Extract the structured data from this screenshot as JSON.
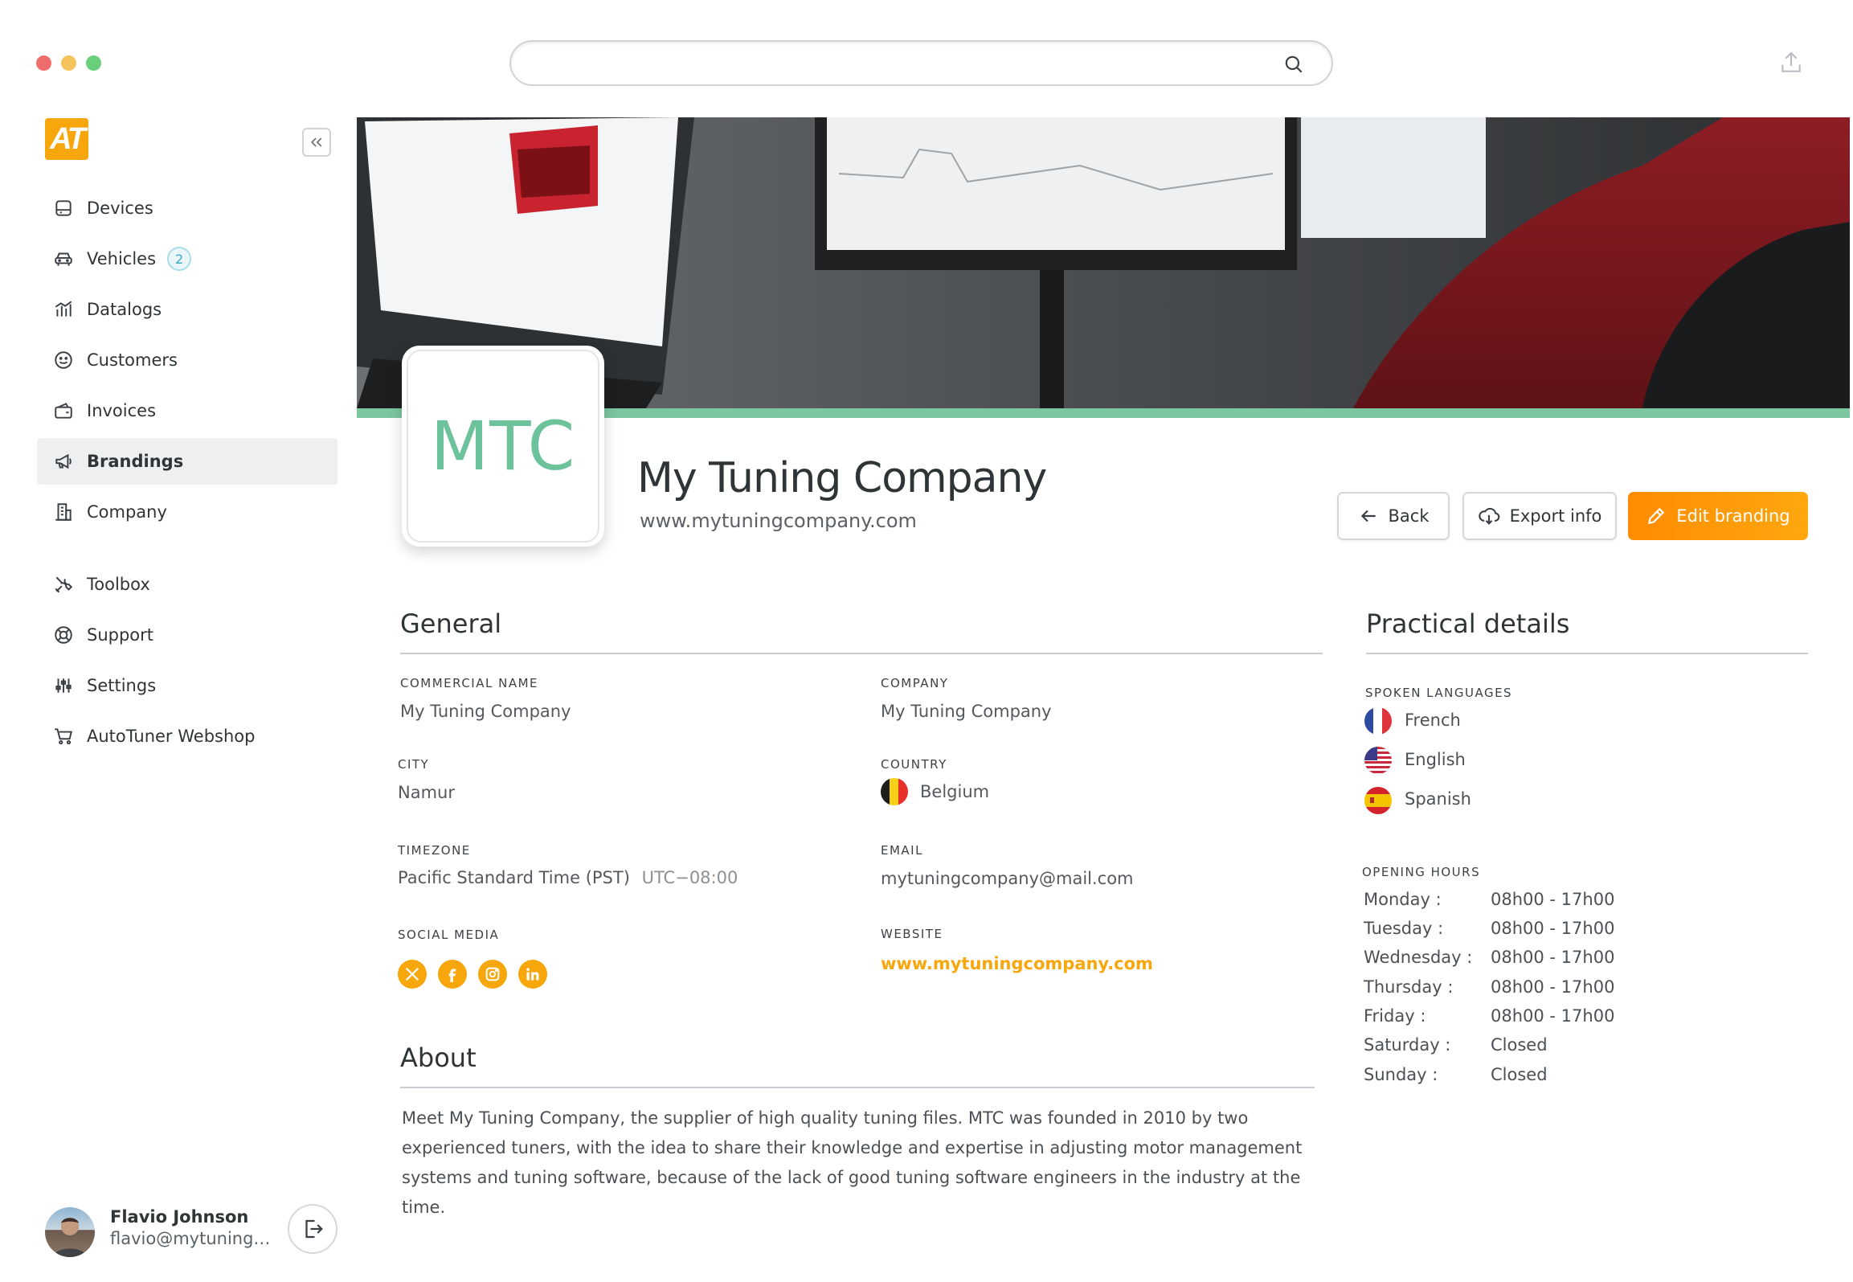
{
  "window": {
    "dots": [
      "#ef6c6c",
      "#f6c25b",
      "#69cf7b"
    ]
  },
  "search": {
    "placeholder": ""
  },
  "logo": {
    "text": "AT"
  },
  "sidebar": {
    "items": [
      {
        "label": "Devices"
      },
      {
        "label": "Vehicles",
        "badge": "2"
      },
      {
        "label": "Datalogs"
      },
      {
        "label": "Customers"
      },
      {
        "label": "Invoices"
      },
      {
        "label": "Brandings",
        "active": true
      },
      {
        "label": "Company"
      },
      {
        "label": "Toolbox"
      },
      {
        "label": "Support"
      },
      {
        "label": "Settings"
      },
      {
        "label": "AutoTuner Webshop"
      }
    ]
  },
  "user": {
    "name": "Flavio Johnson",
    "email": "flavio@mytuningcompany.com"
  },
  "branding": {
    "logo_text": "MTC",
    "name": "My Tuning Company",
    "url": "www.mytuningcompany.com",
    "accent_color": "#7cc6a0"
  },
  "actions": {
    "back": "Back",
    "export": "Export info",
    "edit": "Edit branding"
  },
  "general": {
    "title": "General",
    "commercial_name_label": "COMMERCIAL NAME",
    "commercial_name": "My Tuning Company",
    "company_label": "COMPANY",
    "company": "My Tuning Company",
    "city_label": "CITY",
    "city": "Namur",
    "country_label": "COUNTRY",
    "country": "Belgium",
    "timezone_label": "TIMEZONE",
    "timezone": "Pacific Standard Time (PST)",
    "timezone_offset": "UTC−08:00",
    "email_label": "EMAIL",
    "email": "mytuningcompany@mail.com",
    "social_label": "SOCIAL MEDIA",
    "social": [
      "x",
      "facebook",
      "instagram",
      "linkedin"
    ],
    "website_label": "WEBSITE",
    "website": "www.mytuningcompany.com"
  },
  "about": {
    "title": "About",
    "text": "Meet My Tuning Company, the supplier of high quality tuning files. MTC was founded in 2010 by two experienced tuners, with the idea to share their knowledge and expertise in adjusting motor management systems and tuning software, because of the lack of good tuning software engineers in the industry at the time."
  },
  "practical": {
    "title": "Practical details",
    "languages_label": "SPOKEN LANGUAGES",
    "languages": [
      "French",
      "English",
      "Spanish"
    ],
    "hours_label": "OPENING HOURS",
    "hours": [
      {
        "day": "Monday :",
        "time": "08h00 - 17h00"
      },
      {
        "day": "Tuesday :",
        "time": "08h00 - 17h00"
      },
      {
        "day": "Wednesday :",
        "time": "08h00 - 17h00"
      },
      {
        "day": "Thursday :",
        "time": "08h00 - 17h00"
      },
      {
        "day": "Friday :",
        "time": "08h00 - 17h00"
      },
      {
        "day": "Saturday :",
        "time": "Closed"
      },
      {
        "day": "Sunday :",
        "time": "Closed"
      }
    ]
  }
}
